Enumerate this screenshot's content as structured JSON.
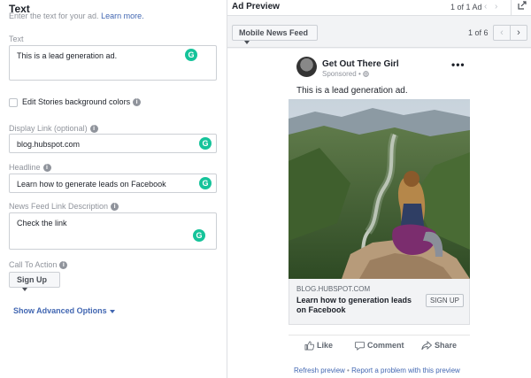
{
  "editor": {
    "section_title": "Text",
    "section_subtitle": "Enter the text for your ad.",
    "learn_more": "Learn more.",
    "text_label": "Text",
    "text_value": "This is a lead generation ad.",
    "stories_checkbox_label": "Edit Stories background colors",
    "display_link_label": "Display Link",
    "display_link_optional": "(optional)",
    "display_link_value": "blog.hubspot.com",
    "headline_label": "Headline",
    "headline_value": "Learn how to generate leads on Facebook",
    "description_label": "News Feed Link Description",
    "description_value": "Check the link",
    "cta_label": "Call To Action",
    "cta_value": "Sign Up",
    "advanced_options": "Show Advanced Options",
    "grammarly_glyph": "G"
  },
  "preview": {
    "title": "Ad Preview",
    "ad_pager": "1 of 1 Ad",
    "placement": "Mobile News Feed",
    "placement_pager": "1 of 6",
    "ad": {
      "page_name": "Get Out There Girl",
      "sponsored": "Sponsored",
      "primary_text": "This is a lead generation ad.",
      "domain": "BLOG.HUBSPOT.COM",
      "headline": "Learn how to generation leads on Facebook",
      "cta": "SIGN UP",
      "like": "Like",
      "comment": "Comment",
      "share": "Share"
    },
    "refresh_link": "Refresh preview",
    "report_link": "Report a problem with this preview",
    "separator": "•"
  },
  "colors": {
    "brand_blue": "#4267b2",
    "grammarly_green": "#15c39a",
    "muted_text": "#90949c"
  },
  "icons": [
    "info-icon",
    "grammarly-icon",
    "caret-down-icon",
    "chevron-left-icon",
    "chevron-right-icon",
    "export-icon",
    "more-icon",
    "globe-icon",
    "like-icon",
    "comment-icon",
    "share-icon"
  ]
}
